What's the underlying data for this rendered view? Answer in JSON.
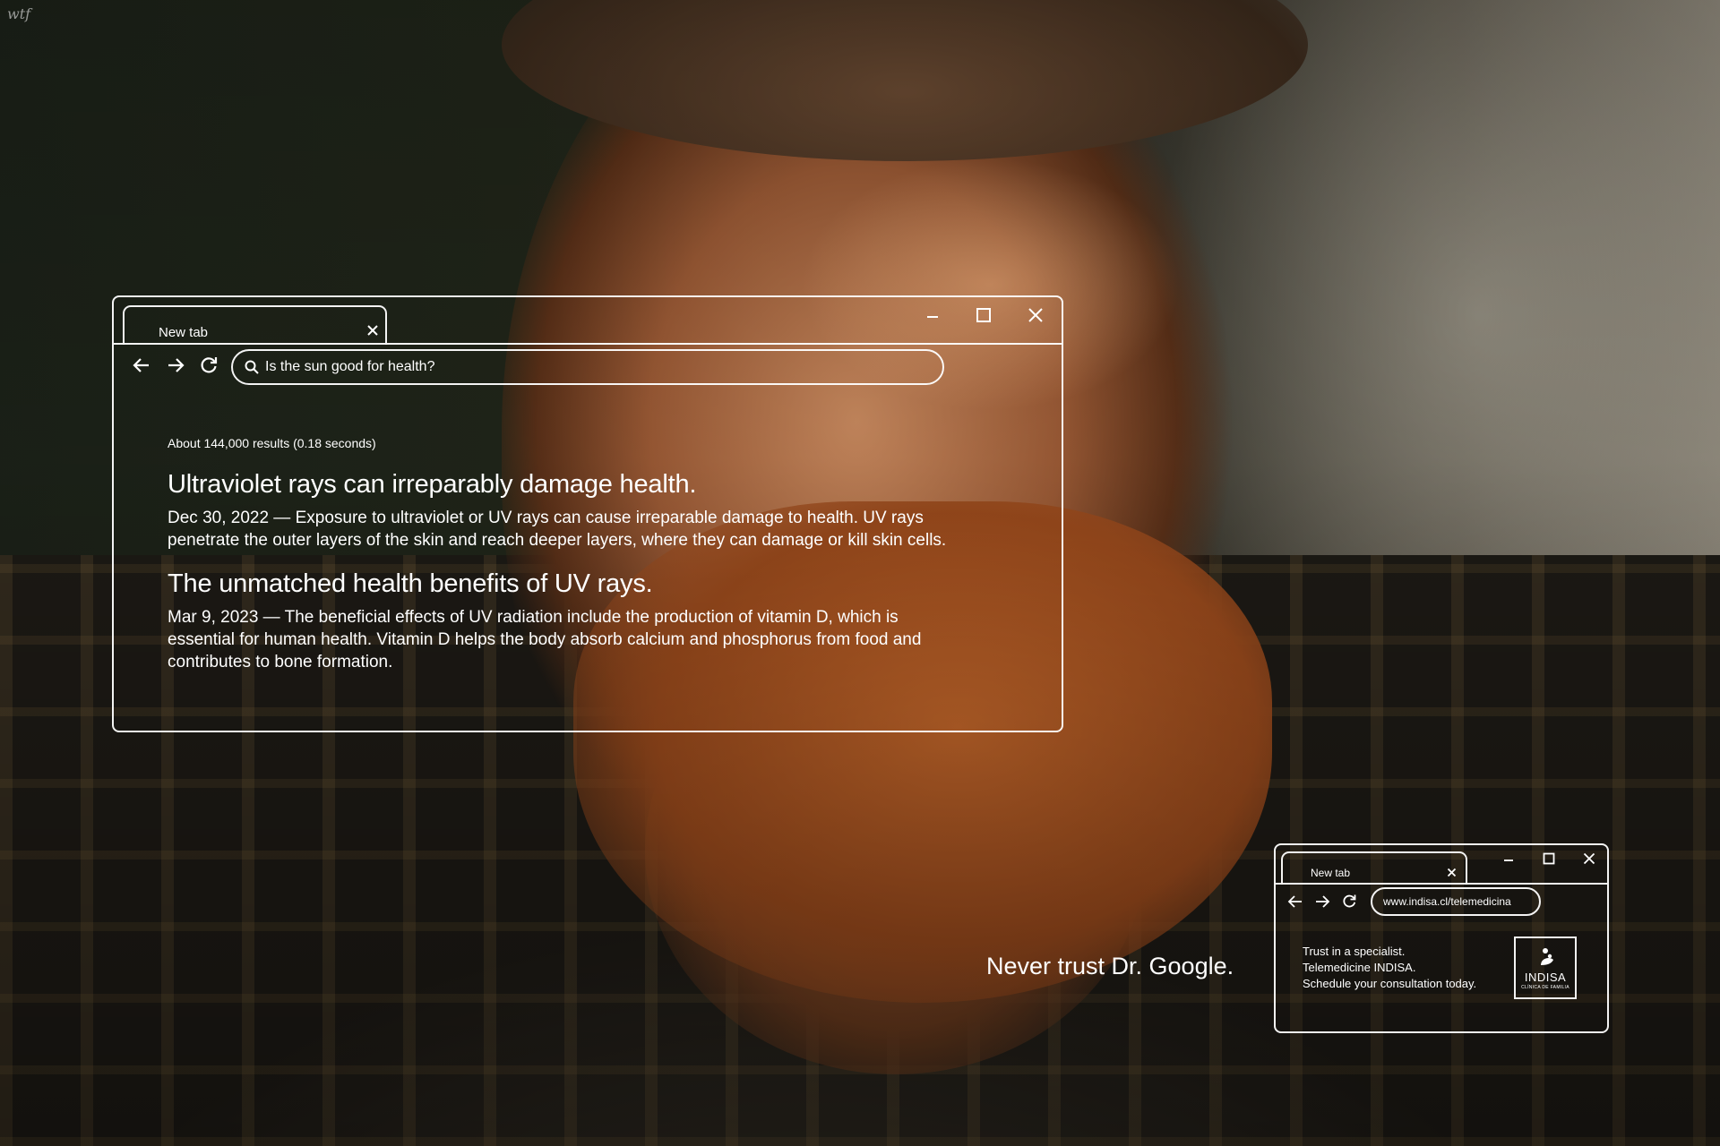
{
  "corner_logo": "wtf",
  "main_browser": {
    "tab_title": "New tab",
    "search_query": "Is the sun good for health?",
    "results_stats": "About 144,000 results (0.18 seconds)",
    "results": [
      {
        "title": "Ultraviolet rays can irreparably damage health.",
        "snippet_lines": [
          "Dec 30, 2022 — Exposure to ultraviolet or UV rays can cause irreparable damage to health. UV rays",
          "penetrate the outer layers of the skin and reach deeper layers, where they can damage or kill skin cells."
        ]
      },
      {
        "title": "The unmatched health benefits of UV rays.",
        "snippet_lines": [
          "Mar 9, 2023 — The beneficial effects of UV radiation include the production of vitamin D, which is",
          "essential for human health. Vitamin D helps the body absorb calcium and phosphorus from food and",
          "contributes to bone formation."
        ]
      }
    ]
  },
  "tagline": "Never trust Dr. Google.",
  "small_browser": {
    "tab_title": "New tab",
    "url": "www.indisa.cl/telemedicina",
    "promo_lines": [
      "Trust in a specialist.",
      "Telemedicine INDISA.",
      "Schedule your consultation today."
    ],
    "brand_name": "INDISA",
    "brand_sub": "CLÍNICA DE FAMILIA"
  },
  "icons": {
    "back": "arrow-left-icon",
    "forward": "arrow-right-icon",
    "reload": "reload-icon",
    "search": "search-icon",
    "close": "close-icon",
    "minimize": "minimize-icon",
    "maximize": "maximize-icon"
  },
  "colors": {
    "outline": "#ffffff"
  }
}
